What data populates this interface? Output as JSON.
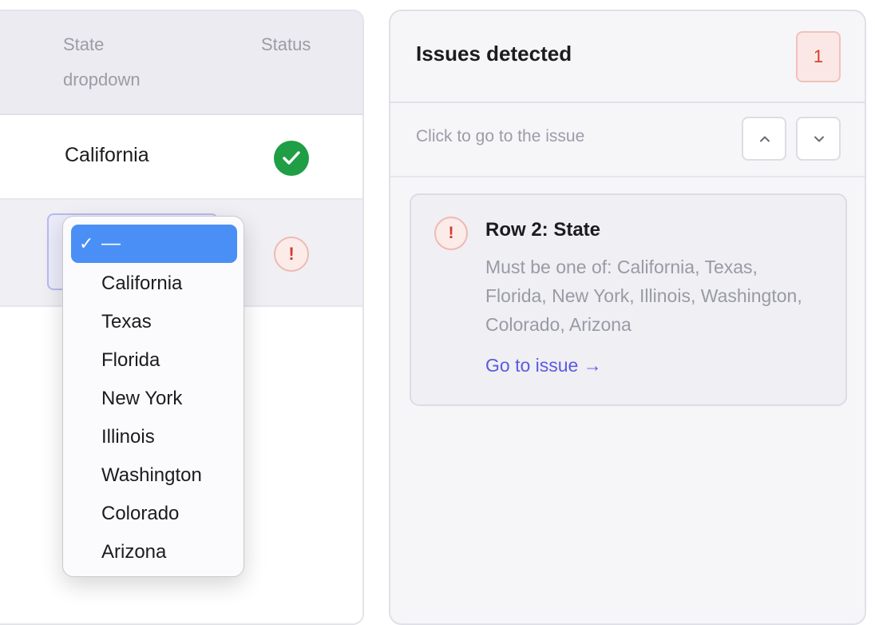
{
  "table": {
    "columns": {
      "state": "State dropdown",
      "status": "Status"
    },
    "rows": [
      {
        "state": "California",
        "status": "valid"
      },
      {
        "state": "",
        "status": "error"
      }
    ]
  },
  "dropdown": {
    "selected": "—",
    "check": "✓",
    "options": [
      "California",
      "Texas",
      "Florida",
      "New York",
      "Illinois",
      "Washington",
      "Colorado",
      "Arizona"
    ]
  },
  "issues": {
    "title": "Issues detected",
    "count": "1",
    "hint": "Click to go to the issue",
    "card": {
      "icon": "!",
      "title": "Row 2: State",
      "description": "Must be one of: California, Texas, Florida, New York, Illinois, Washington, Colorado, Arizona",
      "link": "Go to issue →"
    }
  },
  "icons": {
    "ok": "check-circle-icon",
    "warn": "exclamation-circle-icon",
    "up": "chevron-up-icon",
    "down": "chevron-down-icon"
  },
  "colors": {
    "success": "#1f9e45",
    "error": "#d63b2c",
    "accent": "#4a8ff6",
    "link": "#5b5be0"
  }
}
